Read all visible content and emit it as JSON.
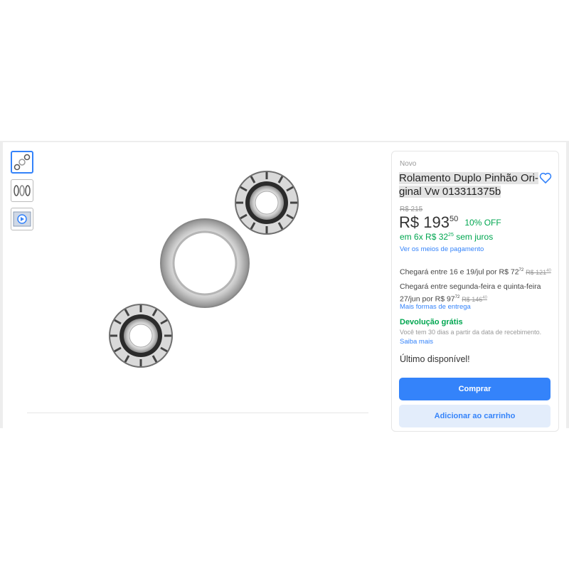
{
  "product": {
    "condition": "Novo",
    "title": "Rolamento Duplo Pinhão Ori-ginal Vw 013311375b",
    "title_line1": "Rolamento Duplo Pinhão Ori-",
    "title_line2": "ginal Vw 013311375b",
    "old_price": "R$ 215",
    "price_currency": "R$",
    "price_int": "193",
    "price_cents": "50",
    "discount": "10% OFF",
    "installments_prefix": "em",
    "installments_text": "6x R$ 32",
    "installments_cents": "25",
    "installments_suffix": "sem juros",
    "payment_link": "Ver os meios de pagamento"
  },
  "shipping": {
    "option1_text": "Chegará entre 16 e 19/jul por R$ 72",
    "option1_cents": "72",
    "option1_old": "R$ 121",
    "option1_old_cents": "40",
    "option2_line1": "Chegará entre segunda-feira e quinta-feira",
    "option2_line2": "27/jun por R$ 97",
    "option2_cents": "72",
    "option2_old": "R$ 146",
    "option2_old_cents": "40",
    "more_link": "Mais formas de entrega"
  },
  "returns": {
    "title": "Devolução grátis",
    "description": "Você tem 30 dias a partir da data de recebimento.",
    "link": "Saiba mais"
  },
  "stock": "Último disponível!",
  "actions": {
    "buy": "Comprar",
    "add_to_cart": "Adicionar ao carrinho"
  },
  "colors": {
    "accent": "#3483fa",
    "green": "#00a650"
  },
  "icons": [
    "heart-icon",
    "play-icon"
  ]
}
